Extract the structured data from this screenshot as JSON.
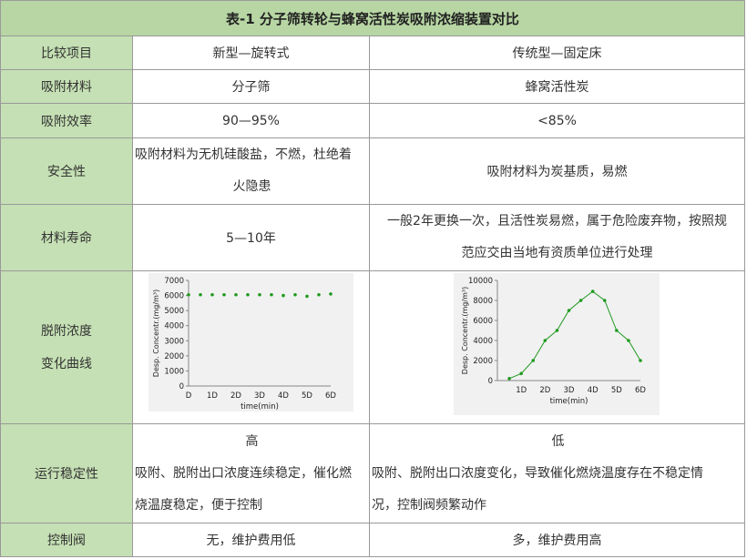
{
  "title": "表-1 分子筛转轮与蜂窝活性炭吸附浓缩装置对比",
  "header": {
    "label": "比较项目",
    "col1": "新型—旋转式",
    "col2": "传统型—固定床"
  },
  "rows": {
    "material": {
      "label": "吸附材料",
      "col1": "分子筛",
      "col2": "蜂窝活性炭"
    },
    "efficiency": {
      "label": "吸附效率",
      "col1": "90—95%",
      "col2": "<85%"
    },
    "safety": {
      "label": "安全性",
      "col1_line1": "吸附材料为无机硅酸盐，不燃，杜绝着",
      "col1_line2": "火隐患",
      "col2": "吸附材料为炭基质，易燃"
    },
    "lifespan": {
      "label": "材料寿命",
      "col1": "5—10年",
      "col2_line1": "一般2年更换一次，且活性炭易燃，属于危险废弃物，按照规",
      "col2_line2": "范应交由当地有资质单位进行处理"
    },
    "curve": {
      "label_line1": "脱附浓度",
      "label_line2": "变化曲线"
    },
    "stability": {
      "label": "运行稳定性",
      "col1_level": "高",
      "col1_line1": "吸附、脱附出口浓度连续稳定，催化燃",
      "col1_line2": "烧温度稳定，便于控制",
      "col2_level": "低",
      "col2_line1": "吸附、脱附出口浓度变化，导致催化燃烧温度存在不稳定情",
      "col2_line2": "况，控制阀频繁动作"
    },
    "valve": {
      "label": "控制阀",
      "col1": "无，维护费用低",
      "col2": "多，维护费用高"
    }
  },
  "colors": {
    "title_bg": "#b7d6a3",
    "label_bg": "#c5e0b4",
    "series": "#1f9a1f"
  },
  "chart_data": [
    {
      "type": "scatter",
      "ylabel": "Desp. Concentr.(mg/m³)",
      "xlabel": "time(min)",
      "categories": [
        "D",
        "1D",
        "2D",
        "3D",
        "4D",
        "5D",
        "6D"
      ],
      "yticks": [
        "0",
        "1000",
        "2000",
        "3000",
        "4000",
        "5000",
        "6000",
        "7000"
      ],
      "ylim": [
        0,
        7000
      ],
      "x": [
        0,
        0.5,
        1,
        1.5,
        2,
        2.5,
        3,
        3.5,
        4,
        4.5,
        5,
        5.5,
        6
      ],
      "values": [
        6050,
        6050,
        6050,
        6050,
        6050,
        6050,
        6050,
        6050,
        6000,
        6050,
        5950,
        6050,
        6100
      ]
    },
    {
      "type": "line",
      "ylabel": "Desp. Concentr.(mg/m³)",
      "xlabel": "time(min)",
      "categories": [
        "1D",
        "2D",
        "3D",
        "4D",
        "5D",
        "6D"
      ],
      "yticks": [
        "0",
        "2000",
        "4000",
        "6000",
        "8000",
        "10000"
      ],
      "ylim": [
        0,
        10000
      ],
      "x": [
        0.5,
        1,
        1.5,
        2,
        2.5,
        3,
        3.5,
        4,
        4.5,
        5,
        5.5,
        6
      ],
      "values": [
        200,
        700,
        2000,
        4000,
        5000,
        7000,
        8000,
        8900,
        8000,
        5000,
        4000,
        2000
      ]
    }
  ]
}
